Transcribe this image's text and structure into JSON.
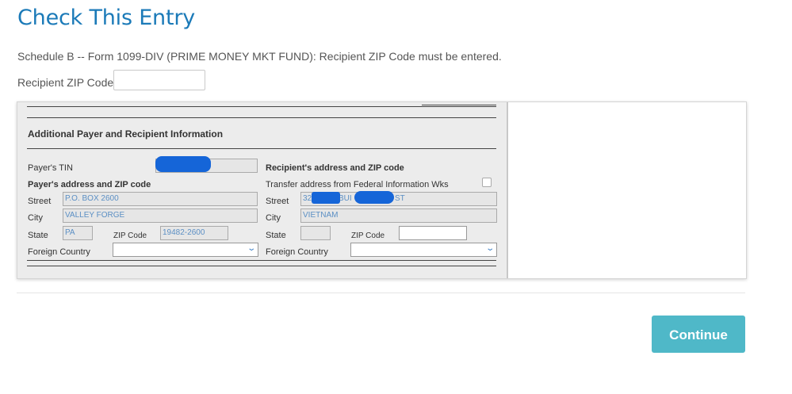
{
  "page": {
    "title": "Check This Entry",
    "message": "Schedule B -- Form 1099-DIV (PRIME MONEY MKT FUND): Recipient ZIP Code must be entered.",
    "zip_label": "Recipient ZIP Code",
    "zip_value": ""
  },
  "form": {
    "section_title": "Additional Payer and Recipient Information",
    "payer": {
      "tin_label": "Payer's TIN",
      "address_header": "Payer's address and ZIP code",
      "street_label": "Street",
      "street_value": "P.O. BOX 2600",
      "city_label": "City",
      "city_value": "VALLEY FORGE",
      "state_label": "State",
      "state_value": "PA",
      "zip_label": "ZIP Code",
      "zip_value": "19482-2600",
      "country_label": "Foreign Country",
      "country_value": ""
    },
    "recipient": {
      "address_header": "Recipient's address and ZIP code",
      "transfer_label": "Transfer address from Federal Information Wks",
      "transfer_checked": false,
      "street_label": "Street",
      "street_part1": "32",
      "street_part2": "BUI",
      "street_part3": "ST",
      "city_label": "City",
      "city_value": "VIETNAM",
      "state_label": "State",
      "state_value": "",
      "zip_label": "ZIP Code",
      "zip_value": "",
      "country_label": "Foreign Country",
      "country_value": ""
    }
  },
  "actions": {
    "continue_label": "Continue"
  },
  "colors": {
    "title": "#1b7ab8",
    "button": "#4fb8c8",
    "redaction": "#1565d8",
    "field_text": "#5b8fc4"
  },
  "icons": {
    "dropdown": "chevron-down-icon"
  }
}
